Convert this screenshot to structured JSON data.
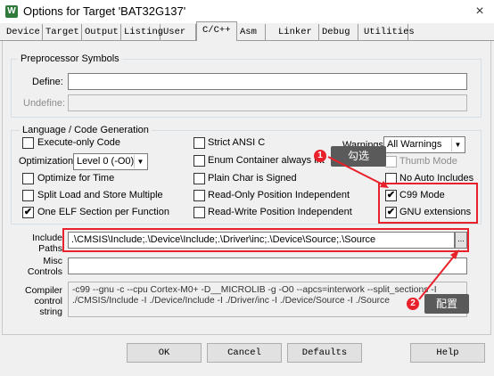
{
  "window": {
    "title": "Options for Target 'BAT32G137'",
    "app_icon": "W",
    "close": "×"
  },
  "tabs": [
    {
      "label": "Device"
    },
    {
      "label": "Target"
    },
    {
      "label": "Output"
    },
    {
      "label": "Listing"
    },
    {
      "label": "User"
    },
    {
      "label": "C/C++"
    },
    {
      "label": "Asm"
    },
    {
      "label": "Linker"
    },
    {
      "label": "Debug"
    },
    {
      "label": "Utilities"
    }
  ],
  "active_tab": "C/C++",
  "preprocessor": {
    "title": "Preprocessor Symbols",
    "define_label": "Define:",
    "define_value": "",
    "undefine_label": "Undefine:",
    "undefine_value": ""
  },
  "codegen": {
    "title": "Language / Code Generation",
    "execute_only": "Execute-only Code",
    "optimization_label": "Optimization:",
    "optimization_value": "Level 0 (-O0)",
    "optimize_time": "Optimize for Time",
    "split_load_store": "Split Load and Store Multiple",
    "one_elf": "One ELF Section per Function",
    "strict_ansi": "Strict ANSI C",
    "enum_container": "Enum Container always int",
    "plain_char": "Plain Char is Signed",
    "ro_pi": "Read-Only Position Independent",
    "rw_pi": "Read-Write Position Independent",
    "warnings_label": "Warnings:",
    "warnings_value": "All Warnings",
    "thumb_mode": "Thumb Mode",
    "no_auto_includes": "No Auto Includes",
    "c99_mode": "C99 Mode",
    "gnu_extensions": "GNU extensions"
  },
  "include": {
    "label_line1": "Include",
    "label_line2": "Paths",
    "value": ".\\CMSIS\\Include;.\\Device\\Include;.\\Driver\\inc;.\\Device\\Source;.\\Source",
    "browse": "..."
  },
  "misc": {
    "label_line1": "Misc",
    "label_line2": "Controls",
    "value": ""
  },
  "compiler": {
    "label_line1": "Compiler",
    "label_line2": "control",
    "label_line3": "string",
    "line1": "-c99 --gnu -c --cpu Cortex-M0+ -D__MICROLIB -g -O0 --apcs=interwork --split_sections -I",
    "line2": "./CMSIS/Include -I ./Device/Include -I ./Driver/inc -I ./Device/Source -I ./Source"
  },
  "annotations": {
    "badge1": "1",
    "callout1": "勾选",
    "badge2": "2",
    "callout2": "配置"
  },
  "buttons": {
    "ok": "OK",
    "cancel": "Cancel",
    "defaults": "Defaults",
    "help": "Help"
  },
  "colors": {
    "annotation_red": "#e8212b",
    "callout_gray": "#5a5a5a"
  }
}
